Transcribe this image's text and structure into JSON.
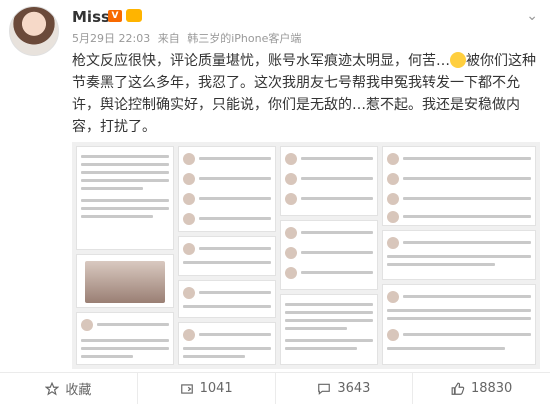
{
  "user": {
    "name": "Miss"
  },
  "meta": {
    "time": "5月29日 22:03",
    "from_prefix": "来自",
    "source": "韩三岁的iPhone客户端"
  },
  "post": {
    "part1": "枪文反应很快，评论质量堪忧，账号水军痕迹太明显，何苦…",
    "part2": "被你们这种节奏黑了这么多年，我忍了。这次我朋友七号帮我申冤我转发一下都不允许，舆论控制确实好，只能说，你们是无敌的…惹不起。我还是安稳做内容，打扰了。"
  },
  "colors": {
    "accent": "#eb7350",
    "vip": "#f86900"
  },
  "toolbar": {
    "favorite_label": "收藏",
    "forward_count": "1041",
    "comment_count": "3643",
    "like_count": "18830"
  },
  "icons": {
    "chevron": "chevron-down-icon",
    "favorite": "star-icon",
    "forward": "forward-icon",
    "comment": "comment-icon",
    "like": "thumbs-up-icon"
  }
}
